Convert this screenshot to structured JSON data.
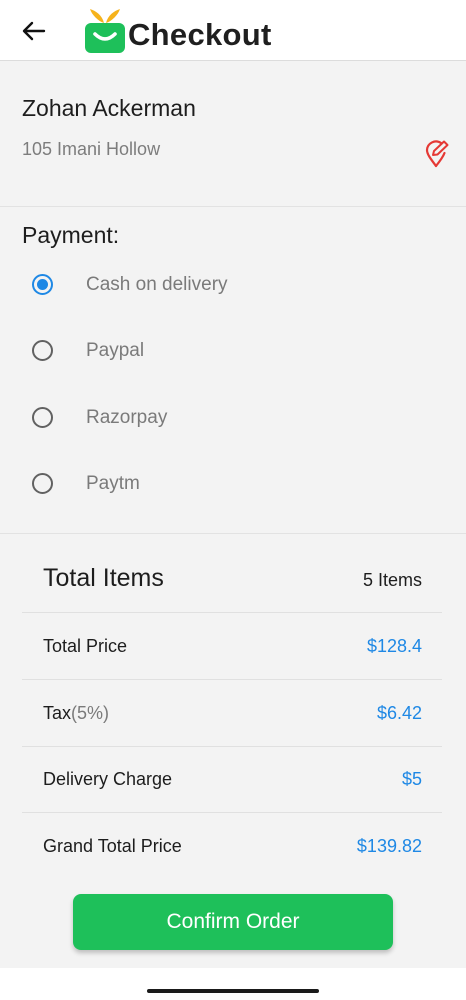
{
  "header": {
    "title": "Checkout",
    "back_icon": "arrow-left-icon",
    "logo_icon": "shopping-basket-logo-icon",
    "logo_colors": {
      "basket": "#1ec05a",
      "leaves": "#f6b31c"
    }
  },
  "address": {
    "name": "Zohan Ackerman",
    "line": "105 Imani Hollow",
    "edit_icon": "edit-location-icon",
    "edit_icon_color": "#e53935"
  },
  "payment": {
    "heading": "Payment:",
    "selected": "Cash on delivery",
    "options": [
      {
        "label": "Cash on delivery",
        "checked": true
      },
      {
        "label": "Paypal",
        "checked": false
      },
      {
        "label": "Razorpay",
        "checked": false
      },
      {
        "label": "Paytm",
        "checked": false
      }
    ]
  },
  "summary": {
    "total_items_label": "Total Items",
    "total_items_value": "5 Items",
    "rows": [
      {
        "label": "Total Price",
        "value": "$128.4"
      },
      {
        "label": "Tax",
        "label_suffix": "(5%)",
        "value": "$6.42"
      },
      {
        "label": "Delivery Charge",
        "value": "$5"
      },
      {
        "label": "Grand Total Price",
        "value": "$139.82"
      }
    ]
  },
  "confirm_button": {
    "label": "Confirm Order"
  },
  "colors": {
    "accent_blue": "#1e88e5",
    "confirm_green": "#1ec05a",
    "background": "#f3f3f3"
  }
}
